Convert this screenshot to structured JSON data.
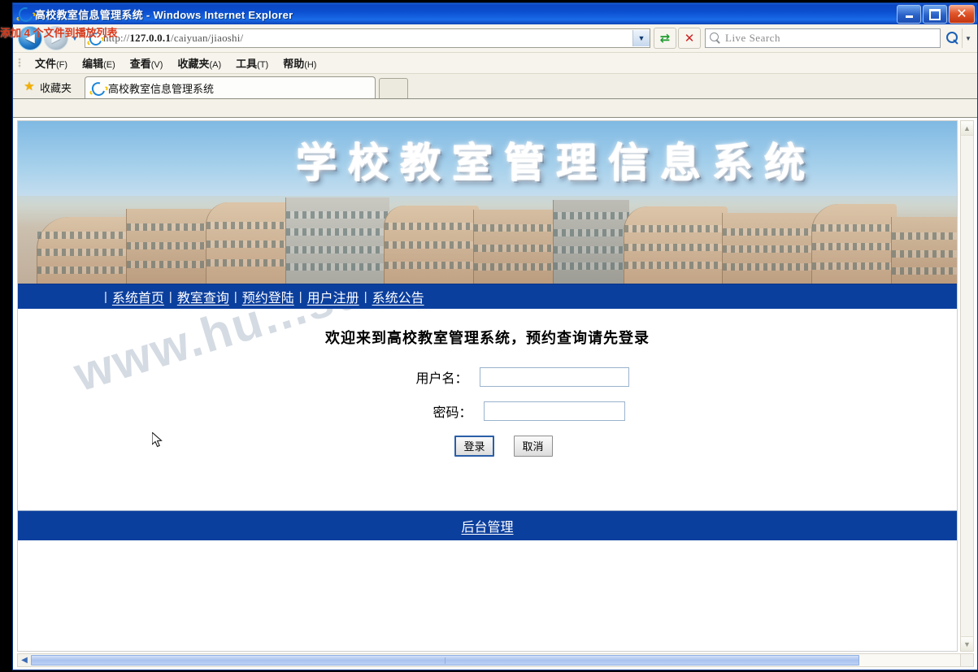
{
  "window": {
    "title": "高校教室信息管理系统 - Windows Internet Explorer",
    "minimize_label": "最小化",
    "maximize_label": "还原",
    "close_label": "关闭"
  },
  "toast": {
    "text": "添加 4 个文件到播放列表"
  },
  "toolbar": {
    "back_label": "后退",
    "forward_label": "前进",
    "history_label": "最近访问的页面",
    "url": "http://127.0.0.1/caiyuan/jiaoshi/",
    "url_scheme": "http://",
    "url_host": "127.0.0.1",
    "url_path": "/caiyuan/jiaoshi/",
    "refresh_label": "刷新",
    "stop_label": "停止",
    "search_placeholder": "Live Search",
    "search_value": "",
    "search_go_label": "搜索",
    "search_drop_label": "搜索选项"
  },
  "menu": {
    "items": [
      {
        "name": "文件",
        "key": "(F)"
      },
      {
        "name": "编辑",
        "key": "(E)"
      },
      {
        "name": "查看",
        "key": "(V)"
      },
      {
        "name": "收藏夹",
        "key": "(A)"
      },
      {
        "name": "工具",
        "key": "(T)"
      },
      {
        "name": "帮助",
        "key": "(H)"
      }
    ]
  },
  "tabs": {
    "favorites_label": "收藏夹",
    "items": [
      {
        "label": "高校教室信息管理系统"
      }
    ],
    "new_tab_label": ""
  },
  "page": {
    "banner_title": "学校教室管理信息系统",
    "nav": [
      {
        "label": "系统首页"
      },
      {
        "label": "教室查询"
      },
      {
        "label": "预约登陆"
      },
      {
        "label": "用户注册"
      },
      {
        "label": "系统公告"
      }
    ],
    "nav_separator": "|",
    "welcome": "欢迎来到高校教室管理系统，预约查询请先登录",
    "form": {
      "username_label": "用户名：",
      "username_value": "",
      "password_label": "密码：",
      "password_value": "",
      "submit_label": "登录",
      "cancel_label": "取消"
    },
    "watermark": "www.hu...sd.com",
    "footer_link": "后台管理"
  },
  "scrollbars": {
    "v_up": "▲",
    "v_down": "▼",
    "h_left": "◀",
    "h_right": "▶"
  },
  "colors": {
    "nav_blue": "#0b3f9e",
    "title_blue": "#0b4fd0",
    "link_white": "#ffffff",
    "toast_red": "#d83a1a"
  }
}
